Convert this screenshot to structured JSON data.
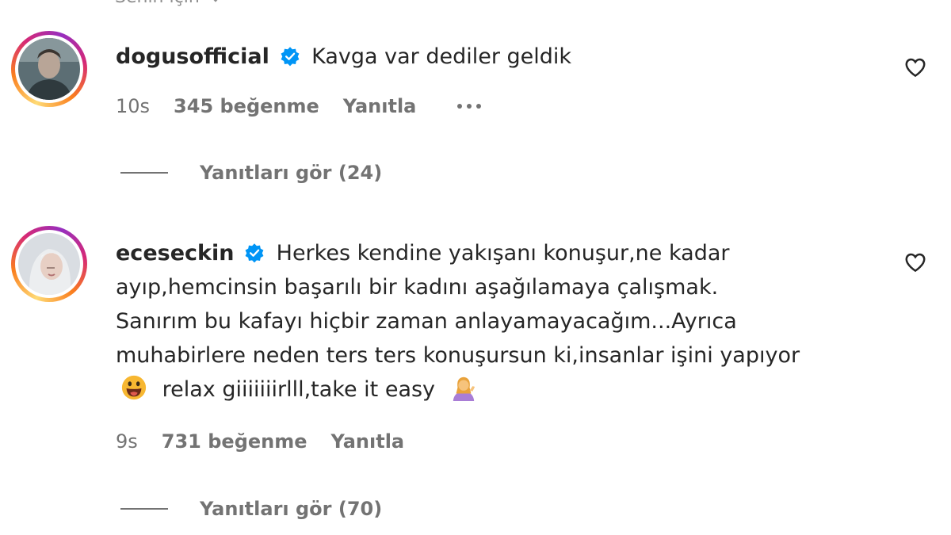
{
  "top_cut_text": "Senin için",
  "comments": [
    {
      "username": "dogusofficial",
      "text": "Kavga var dediler geldik",
      "time": "10s",
      "likes": "345 beğenme",
      "reply_label": "Yanıtla",
      "view_replies": "Yanıtları gör (24)"
    },
    {
      "username": "eceseckin",
      "text_lines": [
        "Herkes kendine yakışanı konuşur,ne kadar",
        "ayıp,hemcinsin başarılı bir kadını aşağılamaya çalışmak.",
        "Sanırım bu kafayı hiçbir zaman anlayamayacağım...Ayrıca",
        "muhabirlere neden ters ters konuşursun ki,insanlar işini yapıyor"
      ],
      "last_line_text": "relax giiiiiiirlll,take it easy",
      "time": "9s",
      "likes": "731 beğenme",
      "reply_label": "Yanıtla",
      "view_replies": "Yanıtları gör (70)"
    }
  ],
  "icons": {
    "verified": "verified-badge-icon",
    "heart": "heart-outline-icon",
    "more": "more-options-icon",
    "emoji_grin": "grinning-face-emoji",
    "emoji_shrug": "person-tipping-hand-emoji"
  },
  "colors": {
    "verified_blue": "#0095f6",
    "meta_gray": "#737373",
    "text": "#262626"
  }
}
